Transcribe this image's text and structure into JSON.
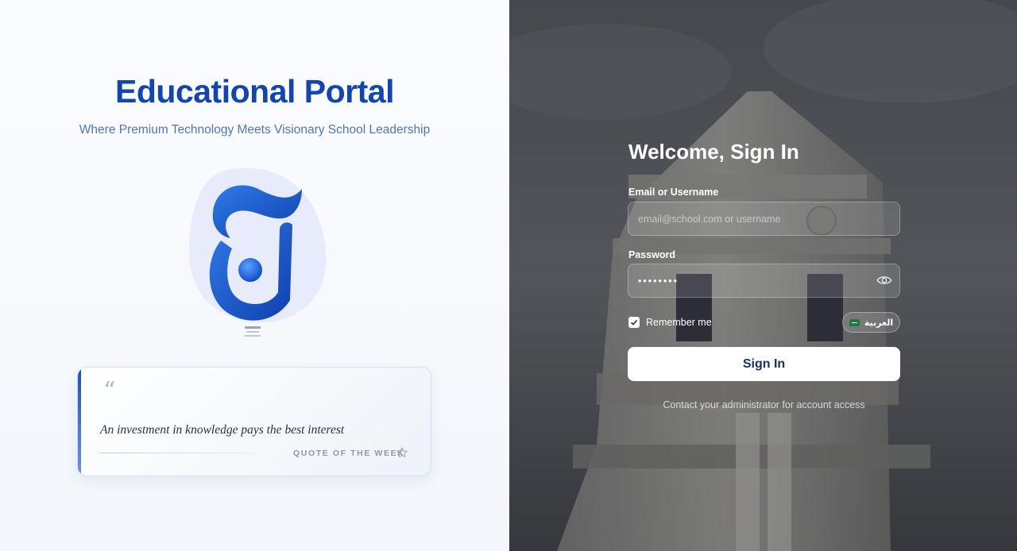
{
  "branding": {
    "title": "Educational Portal",
    "subtitle": "Where Premium Technology Meets Visionary School Leadership",
    "logo_icon": "school-logo-icon"
  },
  "quote": {
    "mark": "“",
    "text": "An investment in knowledge pays the best interest",
    "label": "QUOTE OF THE WEEK",
    "icon": "star-icon"
  },
  "signin": {
    "heading": "Welcome, Sign In",
    "email_label": "Email or Username",
    "email_placeholder": "email@school.com or username",
    "password_label": "Password",
    "password_value": "••••••••",
    "show_password_icon": "eye-icon",
    "remember_label": "Remember me",
    "remember_checked": true,
    "language_label": "العربية",
    "language_flag": "saudi-flag-icon",
    "submit_label": "Sign In",
    "contact_text": "Contact your administrator for account access"
  },
  "colors": {
    "brand_blue": "#1144b4",
    "subtitle_blue": "#4f74c4",
    "button_text": "#1a2f6b"
  }
}
